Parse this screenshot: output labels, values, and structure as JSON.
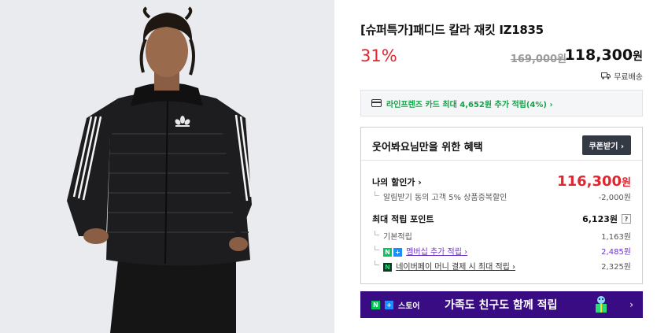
{
  "product": {
    "image_alt": "black quilted jacket with white three-stripe sleeves",
    "title": "[슈퍼특가]패디드 칼라 재킷 IZ1835",
    "discount": "31%",
    "original_price": "169,000원",
    "sale_price": "118,300",
    "sale_price_unit": "원",
    "shipping": "무료배송"
  },
  "card_offer": "라인프렌즈 카드 최대 4,652원 추가 적립(4%) ›",
  "benefit": {
    "title": "웃어봐요님만을 위한 혜택",
    "coupon_button": "쿠폰받기 ›",
    "my_discount_label": "나의 할인가 ›",
    "my_discount_price": "116,300",
    "my_discount_unit": "원",
    "alert_discount_label": "알림받기 동의 고객 5% 상품중복할인",
    "alert_discount_value": "-2,000원",
    "max_points_label": "최대 적립 포인트",
    "max_points_value": "6,123원",
    "help_glyph": "?",
    "basic_points_label": "기본적립",
    "basic_points_value": "1,163원",
    "membership_label": "멤버십 추가 적립 ›",
    "membership_value": "2,485원",
    "npay_label": "네이버페이 머니 결제 시 최대 적립 ›",
    "npay_value": "2,325원"
  },
  "banner": {
    "brand": "스토어",
    "text": "가족도 친구도 함께 적립",
    "chevron": "›"
  },
  "colors": {
    "accent_red": "#e0262f",
    "naver_green": "#03c75a",
    "membership_purple": "#6c33c7",
    "banner_bg": "#3a0c83"
  }
}
